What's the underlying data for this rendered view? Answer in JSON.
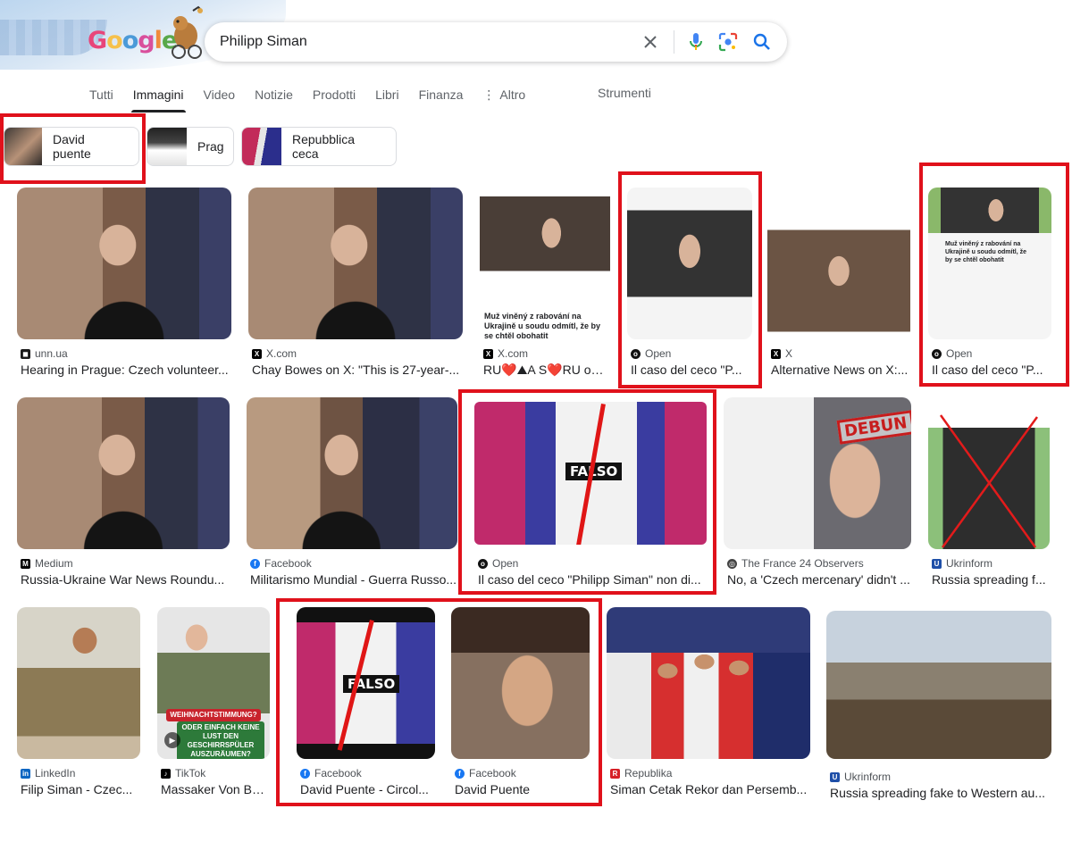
{
  "search": {
    "query": "Philipp Siman"
  },
  "logo": {
    "letters": [
      "G",
      "o",
      "o",
      "g",
      "l",
      "e"
    ]
  },
  "tabs": [
    {
      "label": "Tutti"
    },
    {
      "label": "Immagini",
      "active": true
    },
    {
      "label": "Video"
    },
    {
      "label": "Notizie"
    },
    {
      "label": "Prodotti"
    },
    {
      "label": "Libri"
    },
    {
      "label": "Finanza"
    },
    {
      "label": "Altro"
    }
  ],
  "tools_label": "Strumenti",
  "chips": [
    {
      "label": "David puente"
    },
    {
      "label": "Prag"
    },
    {
      "label": "Repubblica ceca"
    }
  ],
  "results": [
    {
      "source": "unn.ua",
      "title": "Hearing in Prague: Czech volunteer...",
      "fav": "UNN",
      "fav_color": "#1a1a1a"
    },
    {
      "source": "X.com",
      "title": "Chay Bowes on X: \"This is 27-year-...",
      "fav": "X",
      "fav_color": "#000000"
    },
    {
      "source": "X.com",
      "title": "RU❤️⛰A S❤️RU on ...",
      "fav": "X",
      "fav_color": "#000000",
      "overlay": "Muž viněný z rabování na Ukrajině u soudu odmítl, že by se chtěl obohatit"
    },
    {
      "source": "Open",
      "title": "Il caso del ceco \"P...",
      "fav": "O",
      "fav_color": "#111111"
    },
    {
      "source": "X",
      "title": "Alternative News on X:...",
      "fav": "X",
      "fav_color": "#000000"
    },
    {
      "source": "Open",
      "title": "Il caso del ceco \"P...",
      "fav": "O",
      "fav_color": "#111111",
      "overlay": "Muž viněný z rabování na Ukrajině u soudu odmítl, že by se chtěl obohatit"
    },
    {
      "source": "Medium",
      "title": "Russia-Ukraine War News Roundu...",
      "fav": "M",
      "fav_color": "#000000"
    },
    {
      "source": "Facebook",
      "title": "Militarismo Mundial - Guerra Russo...",
      "fav": "f",
      "fav_color": "#1877f2"
    },
    {
      "source": "Open",
      "title": "Il caso del ceco \"Philipp Siman\" non di...",
      "fav": "O",
      "fav_color": "#111111",
      "badge": "FALSO"
    },
    {
      "source": "The France 24 Observers",
      "title": "No, a 'Czech mercenary' didn't ...",
      "fav": "◎",
      "fav_color": "#444444",
      "stamp": "DEBUN"
    },
    {
      "source": "Ukrinform",
      "title": "Russia spreading f...",
      "fav": "U",
      "fav_color": "#1f4fa8"
    },
    {
      "source": "LinkedIn",
      "title": "Filip Siman - Czec...",
      "fav": "in",
      "fav_color": "#0a66c2"
    },
    {
      "source": "TikTok",
      "title": "Massaker Von But...",
      "fav": "♪",
      "fav_color": "#000000",
      "overlay_top": "WEIHNACHTSTIMMUNG?",
      "overlay_bottom": "ODER EINFACH KEINE LUST DEN GESCHIRRSPÜLER AUSZURÄUMEN?"
    },
    {
      "source": "Facebook",
      "title": "David Puente - Circol...",
      "fav": "f",
      "fav_color": "#1877f2",
      "badge": "FALSO"
    },
    {
      "source": "Facebook",
      "title": "David Puente",
      "fav": "f",
      "fav_color": "#1877f2"
    },
    {
      "source": "Republika",
      "title": "Siman Cetak Rekor dan Persemb...",
      "fav": "R",
      "fav_color": "#d61f26"
    },
    {
      "source": "Ukrinform",
      "title": "Russia spreading fake to Western au...",
      "fav": "U",
      "fav_color": "#1f4fa8"
    }
  ],
  "colors": {
    "annotation_red": "#e0111b",
    "accent_blue": "#1a73e8"
  }
}
